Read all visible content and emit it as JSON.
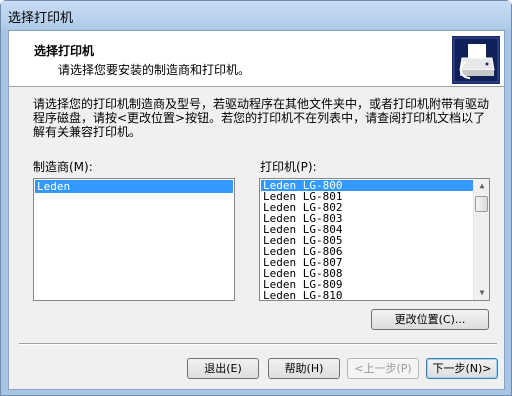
{
  "window": {
    "title": "选择打印机"
  },
  "header": {
    "title": "选择打印机",
    "subtitle": "请选择您要安装的制造商和打印机。",
    "icon": "printer-icon"
  },
  "description": "请选择您的打印机制造商及型号，若驱动程序在其他文件夹中，或者打印机附带有驱动程序磁盘，请按<更改位置>按钮。若您的打印机不在列表中，请查阅打印机文档以了解有关兼容打印机。",
  "manufacturer": {
    "label": "制造商(M):",
    "items": [
      "Leden"
    ],
    "selected": "Leden"
  },
  "printer": {
    "label": "打印机(P):",
    "items": [
      "Leden LG-800",
      "Leden LG-801",
      "Leden LG-802",
      "Leden LG-803",
      "Leden LG-804",
      "Leden LG-805",
      "Leden LG-806",
      "Leden LG-807",
      "Leden LG-808",
      "Leden LG-809",
      "Leden LG-810"
    ],
    "selected": "Leden LG-800"
  },
  "buttons": {
    "change_location": "更改位置(C)...",
    "exit": "退出(E)",
    "help": "帮助(H)",
    "back": "<上一步(P)",
    "next": "下一步(N)>"
  },
  "colors": {
    "selection": "#3399ff",
    "title_bar": "#aecbe9",
    "panel": "#f0f0f0"
  }
}
